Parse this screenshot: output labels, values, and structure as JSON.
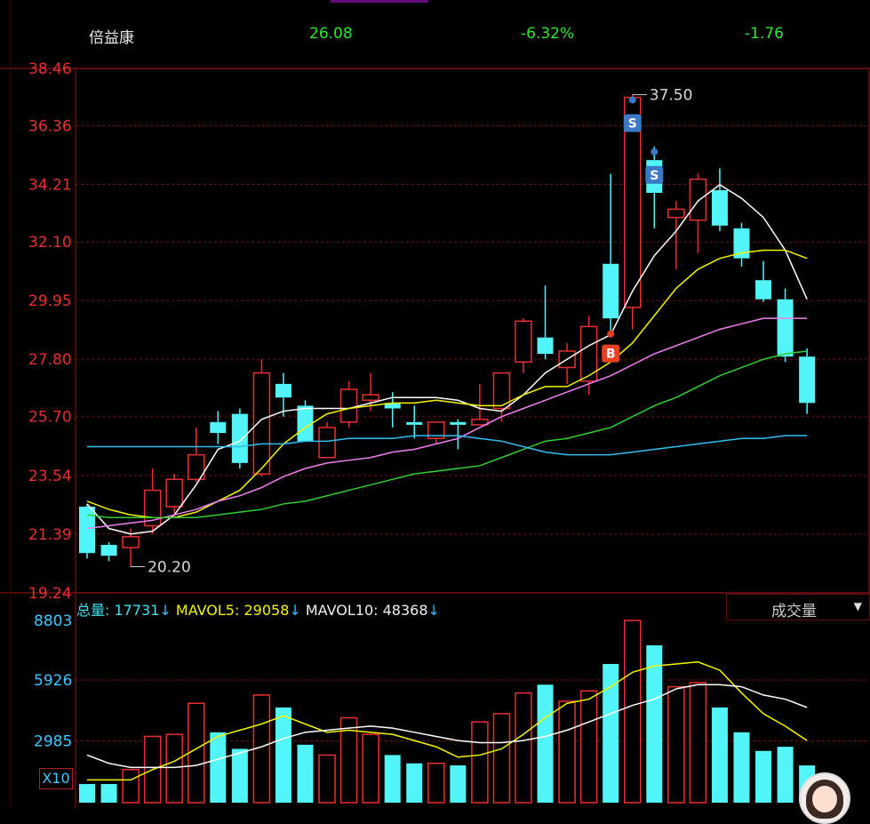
{
  "header": {
    "stock_name": "倍益康",
    "price": "26.08",
    "change_pct": "-6.32%",
    "change": "-1.76"
  },
  "colors": {
    "up": "#e83030",
    "down": "#52f5f8",
    "ma5": "#ffffff",
    "ma10": "#f5f500",
    "ma20": "#f080f0",
    "ma30": "#30d030",
    "ma60": "#30c0f0",
    "axis_price": "#e83030",
    "axis_volume": "#3fc8ff",
    "panel_border": "#6a0e0e"
  },
  "chart_data": {
    "type": "candlestick",
    "y_ticks": [
      "38.46",
      "36.36",
      "34.21",
      "32.10",
      "29.95",
      "27.80",
      "25.70",
      "23.54",
      "21.39",
      "19.24"
    ],
    "ylim": [
      19.24,
      38.46
    ],
    "high_label": "37.50",
    "low_label": "20.20",
    "candles": [
      {
        "o": 22.4,
        "h": 22.5,
        "c": 20.7,
        "l": 20.5
      },
      {
        "o": 21.0,
        "h": 21.1,
        "c": 20.6,
        "l": 20.4
      },
      {
        "o": 20.9,
        "h": 21.6,
        "c": 21.3,
        "l": 20.2
      },
      {
        "o": 21.7,
        "h": 23.8,
        "c": 23.0,
        "l": 21.4
      },
      {
        "o": 22.4,
        "h": 23.6,
        "c": 23.4,
        "l": 22.0
      },
      {
        "o": 23.4,
        "h": 25.3,
        "c": 24.3,
        "l": 23.3
      },
      {
        "o": 25.5,
        "h": 25.9,
        "c": 25.1,
        "l": 24.7
      },
      {
        "o": 25.8,
        "h": 26.0,
        "c": 24.0,
        "l": 23.8
      },
      {
        "o": 23.6,
        "h": 27.8,
        "c": 27.3,
        "l": 23.5
      },
      {
        "o": 26.9,
        "h": 27.3,
        "c": 26.4,
        "l": 25.7
      },
      {
        "o": 26.1,
        "h": 26.3,
        "c": 24.8,
        "l": 24.8
      },
      {
        "o": 24.2,
        "h": 25.5,
        "c": 25.3,
        "l": 24.2
      },
      {
        "o": 25.5,
        "h": 27.0,
        "c": 26.7,
        "l": 25.3
      },
      {
        "o": 26.3,
        "h": 27.3,
        "c": 26.5,
        "l": 25.9
      },
      {
        "o": 26.2,
        "h": 26.6,
        "c": 26.0,
        "l": 25.3
      },
      {
        "o": 25.5,
        "h": 26.1,
        "c": 25.4,
        "l": 24.9
      },
      {
        "o": 24.9,
        "h": 25.4,
        "c": 25.5,
        "l": 24.7
      },
      {
        "o": 25.5,
        "h": 25.6,
        "c": 25.4,
        "l": 24.5
      },
      {
        "o": 25.4,
        "h": 26.9,
        "c": 25.6,
        "l": 25.4
      },
      {
        "o": 26.0,
        "h": 26.9,
        "c": 27.3,
        "l": 25.5
      },
      {
        "o": 27.7,
        "h": 29.3,
        "c": 29.2,
        "l": 27.3
      },
      {
        "o": 28.6,
        "h": 30.5,
        "c": 28.0,
        "l": 27.8
      },
      {
        "o": 27.5,
        "h": 28.4,
        "c": 28.1,
        "l": 26.9
      },
      {
        "o": 27.0,
        "h": 29.4,
        "c": 29.0,
        "l": 26.5
      },
      {
        "o": 31.3,
        "h": 34.6,
        "c": 29.3,
        "l": 28.6
      },
      {
        "o": 29.7,
        "h": 37.5,
        "c": 37.4,
        "l": 28.9
      },
      {
        "o": 35.1,
        "h": 35.6,
        "c": 33.9,
        "l": 32.6
      },
      {
        "o": 33.0,
        "h": 33.6,
        "c": 33.3,
        "l": 31.1
      },
      {
        "o": 32.9,
        "h": 34.6,
        "c": 34.4,
        "l": 31.7
      },
      {
        "o": 34.0,
        "h": 34.8,
        "c": 32.7,
        "l": 32.5
      },
      {
        "o": 32.6,
        "h": 32.8,
        "c": 31.5,
        "l": 31.2
      },
      {
        "o": 30.7,
        "h": 31.4,
        "c": 30.0,
        "l": 29.9
      },
      {
        "o": 30.0,
        "h": 30.4,
        "c": 27.9,
        "l": 27.7
      },
      {
        "o": 27.9,
        "h": 28.2,
        "c": 26.2,
        "l": 25.8
      }
    ],
    "ma_series": [
      {
        "key": "ma5",
        "values": [
          22.5,
          21.6,
          21.4,
          21.5,
          22.1,
          23.2,
          24.5,
          24.8,
          25.6,
          25.9,
          26.0,
          26.0,
          26.0,
          26.2,
          26.4,
          26.4,
          26.4,
          26.3,
          26.0,
          25.9,
          26.5,
          27.3,
          27.8,
          28.3,
          28.7,
          30.3,
          31.6,
          32.5,
          33.6,
          34.2,
          33.7,
          33.0,
          31.8,
          30.0
        ]
      },
      {
        "key": "ma10",
        "values": [
          22.6,
          22.3,
          22.1,
          22.0,
          22.0,
          22.2,
          22.6,
          23.0,
          23.8,
          24.7,
          25.3,
          25.8,
          26.0,
          26.1,
          26.2,
          26.2,
          26.3,
          26.2,
          26.1,
          26.1,
          26.5,
          26.8,
          26.8,
          27.2,
          27.7,
          28.4,
          29.4,
          30.4,
          31.1,
          31.5,
          31.7,
          31.8,
          31.8,
          31.5
        ]
      },
      {
        "key": "ma20",
        "values": [
          21.6,
          21.7,
          21.8,
          21.9,
          22.1,
          22.3,
          22.6,
          22.8,
          23.1,
          23.5,
          23.8,
          24.0,
          24.1,
          24.2,
          24.4,
          24.5,
          24.7,
          24.9,
          25.3,
          25.7,
          26.0,
          26.3,
          26.6,
          26.9,
          27.2,
          27.6,
          28.0,
          28.3,
          28.6,
          28.9,
          29.1,
          29.3,
          29.3,
          29.3
        ]
      },
      {
        "key": "ma30",
        "values": [
          22.1,
          22.0,
          22.0,
          22.0,
          22.0,
          22.0,
          22.1,
          22.2,
          22.3,
          22.5,
          22.6,
          22.8,
          23.0,
          23.2,
          23.4,
          23.6,
          23.7,
          23.8,
          23.9,
          24.2,
          24.5,
          24.8,
          24.9,
          25.1,
          25.3,
          25.7,
          26.1,
          26.4,
          26.8,
          27.2,
          27.5,
          27.8,
          28.0,
          28.1
        ]
      },
      {
        "key": "ma60",
        "values": [
          24.6,
          24.6,
          24.6,
          24.6,
          24.6,
          24.6,
          24.6,
          24.6,
          24.7,
          24.7,
          24.8,
          24.8,
          24.9,
          24.9,
          24.9,
          25.0,
          25.0,
          25.0,
          24.9,
          24.8,
          24.6,
          24.4,
          24.3,
          24.3,
          24.3,
          24.4,
          24.5,
          24.6,
          24.7,
          24.8,
          24.9,
          24.9,
          25.0,
          25.0
        ]
      }
    ],
    "signals": [
      {
        "index": 24,
        "type": "B"
      },
      {
        "index": 25,
        "type": "S"
      },
      {
        "index": 26,
        "type": "S"
      }
    ],
    "volume": {
      "y_ticks": [
        "8803",
        "5926",
        "2985"
      ],
      "ylim": [
        0,
        8803
      ],
      "multiplier_label": "X10",
      "values": [
        900,
        900,
        1600,
        3200,
        3300,
        4800,
        3400,
        2600,
        5200,
        4600,
        2800,
        2300,
        4100,
        3300,
        2300,
        1900,
        1900,
        1800,
        3900,
        4300,
        5300,
        5700,
        4900,
        5400,
        6700,
        8803,
        7600,
        5600,
        5800,
        4600,
        3400,
        2500,
        2700,
        1800
      ],
      "mavol5": [
        1100,
        1100,
        1100,
        1600,
        2000,
        2600,
        3200,
        3500,
        3800,
        4200,
        3800,
        3400,
        3500,
        3400,
        3300,
        3000,
        2700,
        2200,
        2300,
        2600,
        3300,
        4100,
        4800,
        5000,
        5600,
        6300,
        6600,
        6700,
        6800,
        6400,
        5300,
        4300,
        3700,
        3000
      ],
      "mavol10": [
        2300,
        1900,
        1700,
        1700,
        1700,
        1800,
        2100,
        2400,
        2700,
        3100,
        3400,
        3500,
        3600,
        3700,
        3600,
        3400,
        3200,
        3000,
        2900,
        2900,
        3000,
        3200,
        3500,
        3900,
        4300,
        4700,
        5000,
        5500,
        5700,
        5700,
        5600,
        5200,
        5000,
        4600
      ]
    }
  },
  "volume_legend": {
    "total_label": "总量:",
    "total_value": "17731",
    "mavol5_label": "MAVOL5:",
    "mavol5_value": "29058",
    "mavol10_label": "MAVOL10:",
    "mavol10_value": "48368",
    "arrow": "↓"
  },
  "indicator_dropdown": {
    "selected": "成交量",
    "icon": "caret-down-icon"
  }
}
